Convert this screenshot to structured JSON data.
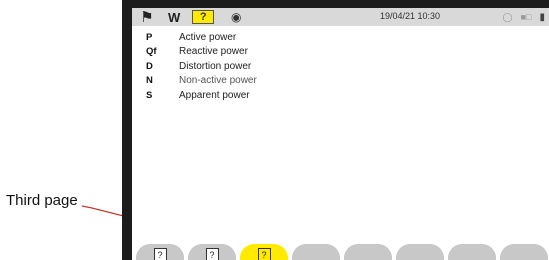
{
  "callout": {
    "label": "Third page"
  },
  "status_bar": {
    "mode": "W",
    "help_icon_glyph": "?",
    "datetime": "19/04/21 10:30",
    "icons": [
      "home-icon",
      "help-icon",
      "camera-icon",
      "recording-icon",
      "sensor-icon",
      "network-icon",
      "battery-icon"
    ]
  },
  "legend": [
    {
      "symbol": "P",
      "label": "Active power"
    },
    {
      "symbol": "Qf",
      "label": "Reactive power"
    },
    {
      "symbol": "D",
      "label": "Distortion power"
    },
    {
      "symbol": "N",
      "label": "Non-active power"
    },
    {
      "symbol": "S",
      "label": "Apparent power"
    }
  ],
  "softkeys": [
    {
      "icon": "help-page-1-icon",
      "active": false
    },
    {
      "icon": "help-page-2-icon",
      "active": false
    },
    {
      "icon": "help-page-3-icon",
      "active": true
    },
    {
      "icon": "",
      "active": false
    },
    {
      "icon": "",
      "active": false
    },
    {
      "icon": "",
      "active": false
    },
    {
      "icon": "",
      "active": false
    },
    {
      "icon": "",
      "active": false
    }
  ],
  "colors": {
    "highlight": "#ffea00",
    "frame": "#1c1c1c",
    "status_bar": "#d9d9d9",
    "callout_line": "#c0392b"
  }
}
